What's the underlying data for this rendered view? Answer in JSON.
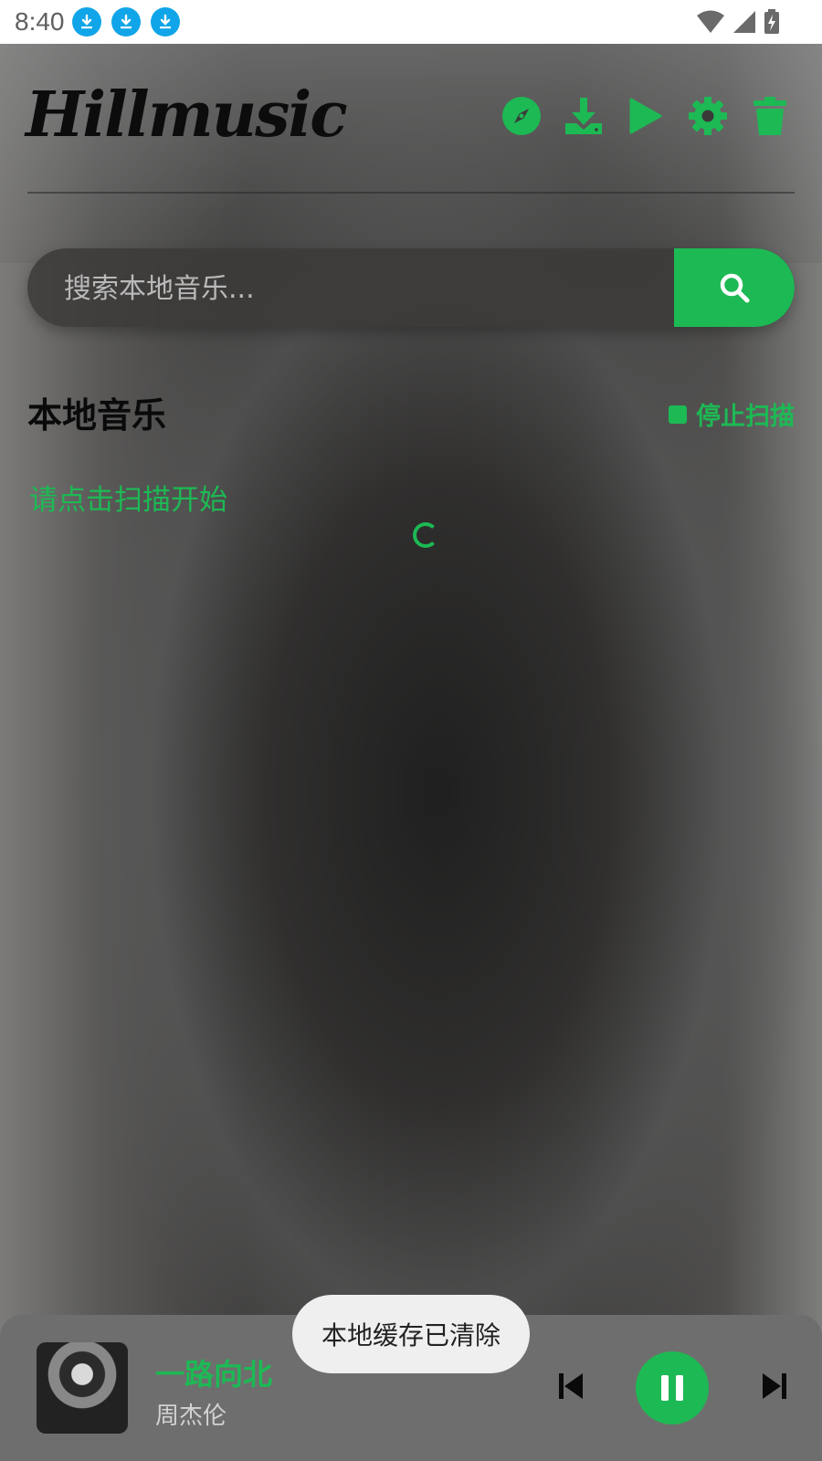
{
  "status_bar": {
    "time": "8:40",
    "notification_icons": [
      "download-icon",
      "download-icon",
      "download-icon"
    ],
    "system_icons": [
      "wifi-icon",
      "signal-icon",
      "battery-charging-icon"
    ]
  },
  "header": {
    "logo_text": "Hillmusic",
    "actions": [
      "compass-icon",
      "download-icon",
      "play-icon",
      "gear-icon",
      "trash-icon"
    ]
  },
  "search": {
    "placeholder": "搜索本地音乐...",
    "button_icon": "search-icon"
  },
  "section": {
    "title": "本地音乐",
    "stop_scan_label": "停止扫描",
    "hint": "请点击扫描开始"
  },
  "player": {
    "song_title": "一路向北",
    "artist": "周杰伦",
    "state": "playing"
  },
  "toast": {
    "message": "本地缓存已清除"
  },
  "colors": {
    "accent": "#1db954",
    "status_badge": "#10a5e8"
  }
}
